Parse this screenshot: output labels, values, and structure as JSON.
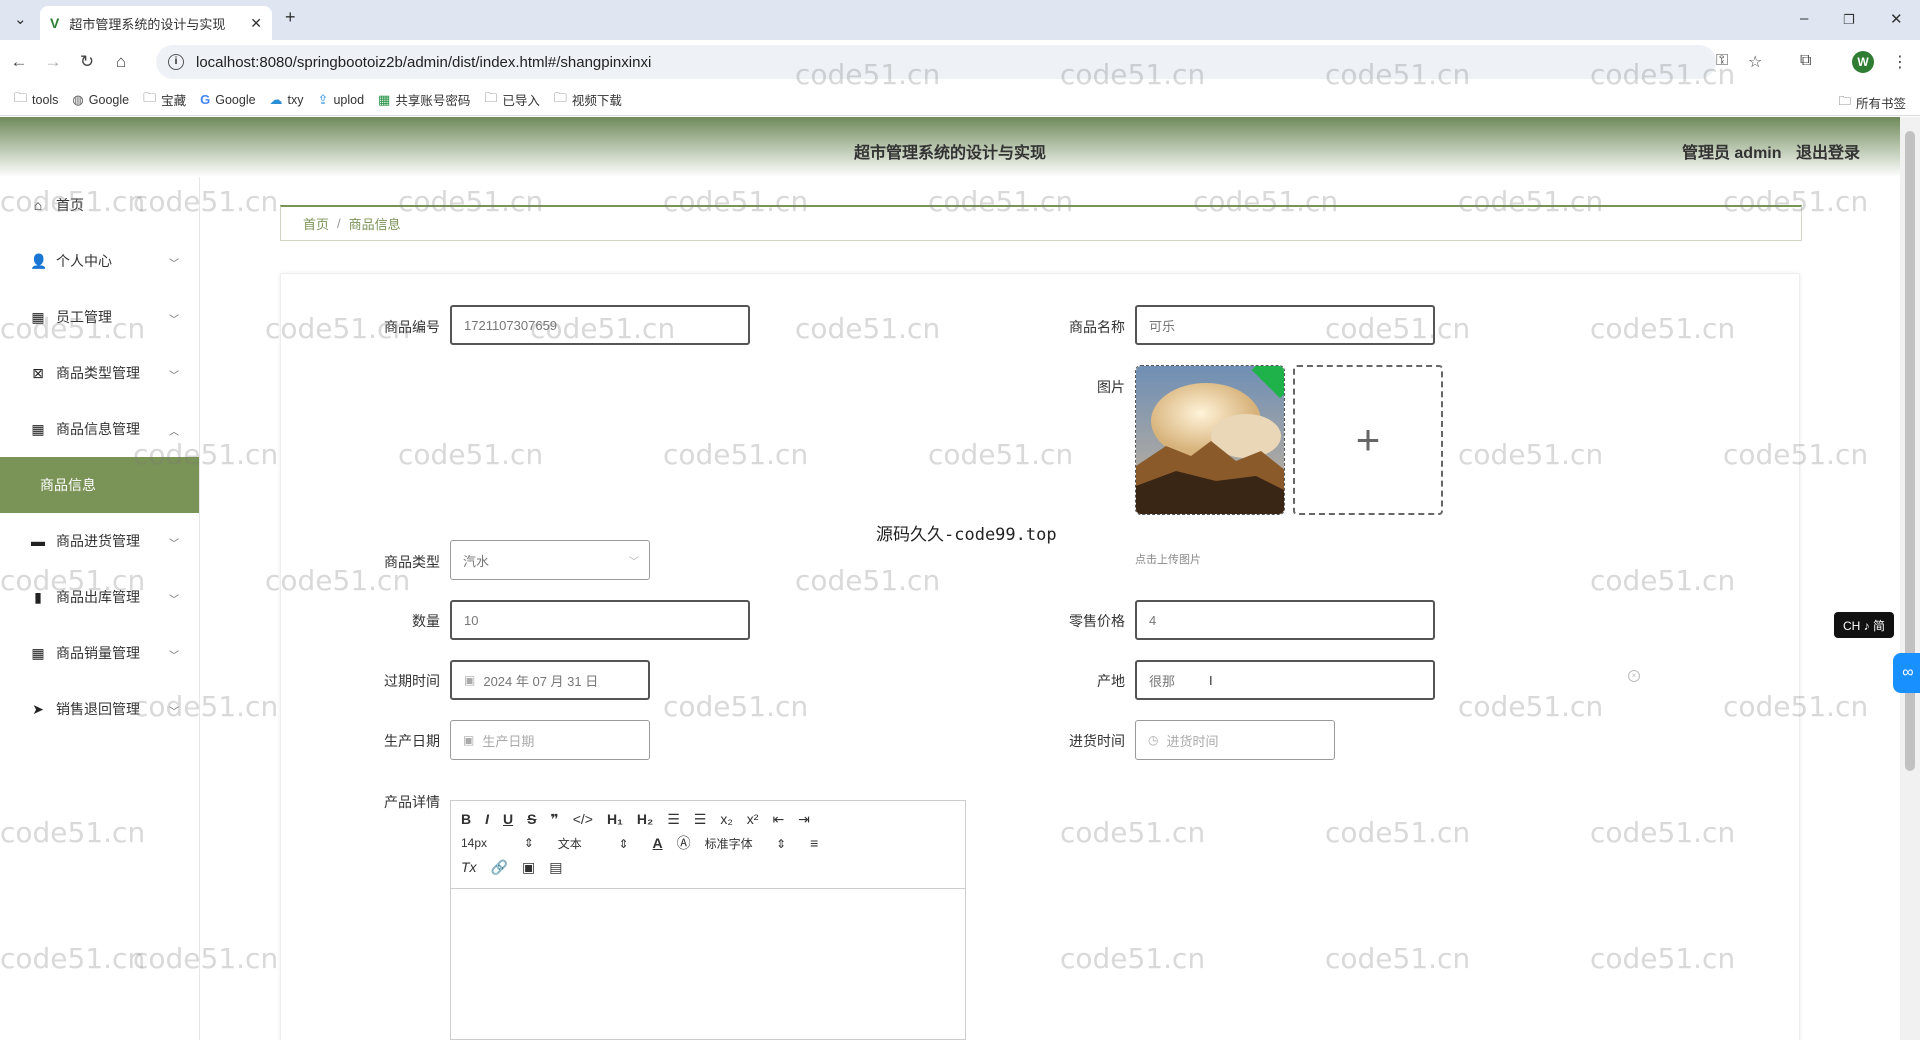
{
  "browser": {
    "tab_title": "超市管理系统的设计与实现",
    "url": "localhost:8080/springbootoiz2b/admin/dist/index.html#/shangpinxinxi",
    "profile_initial": "W",
    "bookmarks": [
      {
        "icon": "folder-icon",
        "label": "tools"
      },
      {
        "icon": "globe-icon",
        "label": "Google"
      },
      {
        "icon": "folder-icon",
        "label": "宝藏"
      },
      {
        "icon": "google-icon",
        "label": "Google"
      },
      {
        "icon": "cloud-icon",
        "label": "txy"
      },
      {
        "icon": "upload-icon",
        "label": "uplod"
      },
      {
        "icon": "sheet-icon",
        "label": "共享账号密码"
      },
      {
        "icon": "folder-icon",
        "label": "已导入"
      },
      {
        "icon": "folder-icon",
        "label": "视频下载"
      }
    ],
    "all_bookmarks": "所有书签"
  },
  "header": {
    "title": "超市管理系统的设计与实现",
    "user": "管理员 admin",
    "logout": "退出登录"
  },
  "sidebar": {
    "items": [
      {
        "label": "首页",
        "icon": "home-icon"
      },
      {
        "label": "个人中心",
        "icon": "user-icon"
      },
      {
        "label": "员工管理",
        "icon": "grid-icon"
      },
      {
        "label": "商品类型管理",
        "icon": "box-icon"
      },
      {
        "label": "商品信息管理",
        "icon": "grid-icon"
      },
      {
        "label": "商品信息",
        "icon": ""
      },
      {
        "label": "商品进货管理",
        "icon": "chat-icon"
      },
      {
        "label": "商品出库管理",
        "icon": "chart-icon"
      },
      {
        "label": "商品销量管理",
        "icon": "grid-icon"
      },
      {
        "label": "销售退回管理",
        "icon": "send-icon"
      }
    ]
  },
  "breadcrumb": {
    "home": "首页",
    "current": "商品信息"
  },
  "form": {
    "code_label": "商品编号",
    "code_value": "1721107307659",
    "name_label": "商品名称",
    "name_value": "可乐",
    "image_label": "图片",
    "upload_tip": "点击上传图片",
    "type_label": "商品类型",
    "type_value": "汽水",
    "qty_label": "数量",
    "qty_value": "10",
    "price_label": "零售价格",
    "price_value": "4",
    "expire_label": "过期时间",
    "expire_value": "2024 年 07 月 31 日",
    "origin_label": "产地",
    "origin_value": "很那",
    "prod_label": "生产日期",
    "prod_placeholder": "生产日期",
    "stock_label": "进货时间",
    "stock_placeholder": "进货时间",
    "detail_label": "产品详情"
  },
  "editor": {
    "font_size": "14px",
    "text_type": "文本",
    "font_family": "标准字体"
  },
  "overlay_text": "源码久久-code99.top",
  "watermark": "code51.cn",
  "lang_badge": "CH ♪ 简"
}
